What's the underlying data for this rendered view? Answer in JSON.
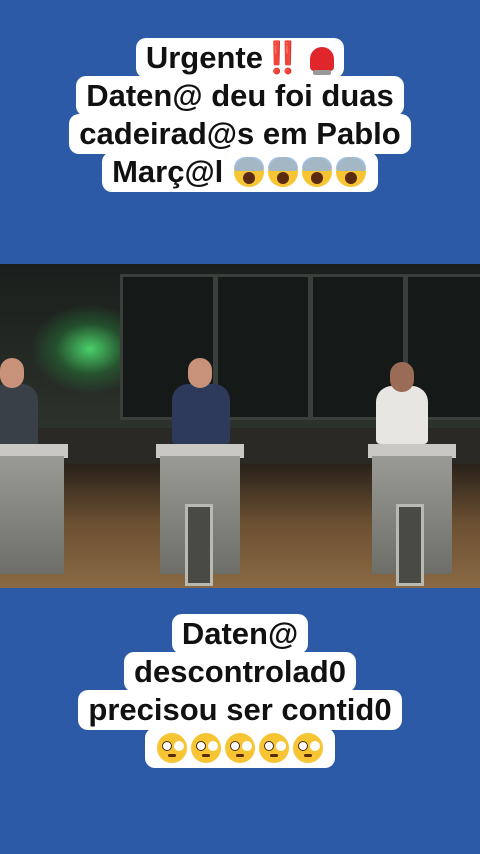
{
  "top_caption": {
    "line1": "Urgente",
    "line1_bang": "‼️",
    "line2": "Daten@ deu foi duas",
    "line3": "cadeirad@s em Pablo",
    "line4": "Març@l"
  },
  "bottom_caption": {
    "line1": "Daten@",
    "line2": "descontrolad0",
    "line3": "precisou ser contid0"
  },
  "colors": {
    "background": "#2d5aa6",
    "caption_bg": "#ffffff"
  },
  "icons": {
    "alarm": "police-siren-icon",
    "scream": "face-screaming-icon",
    "flushed": "flushed-face-icon"
  }
}
